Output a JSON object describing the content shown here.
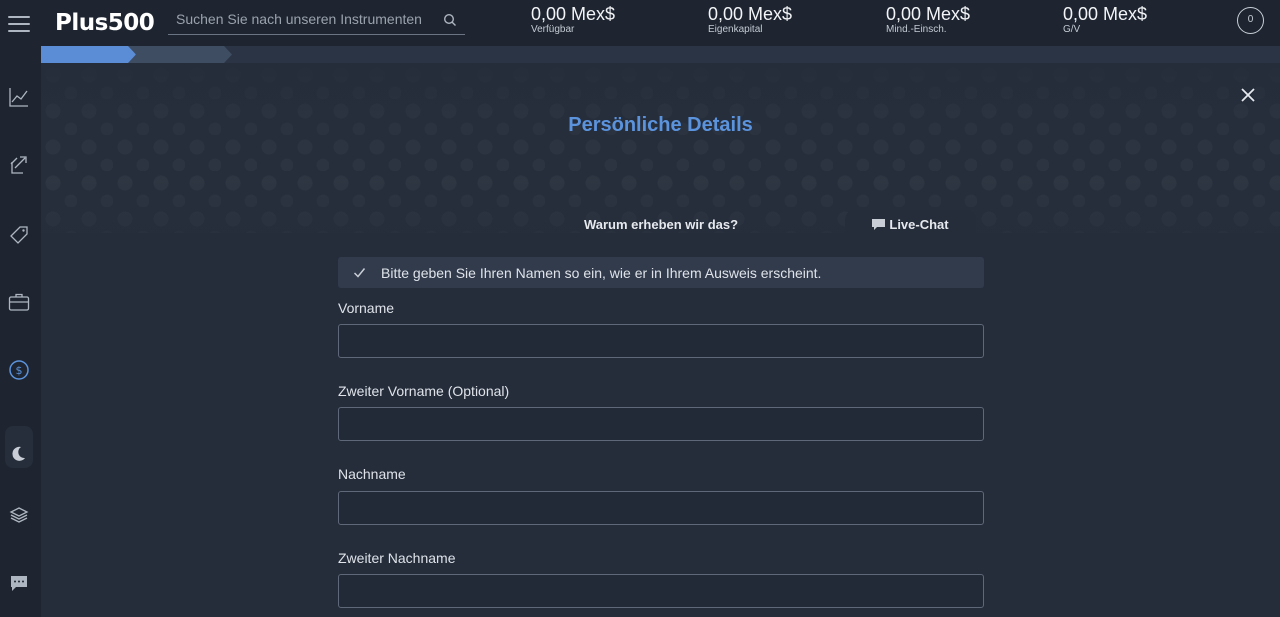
{
  "header": {
    "brand": "Plus500",
    "search": {
      "placeholder": "Suchen Sie nach unseren Instrumenten",
      "value": ""
    },
    "stats": [
      {
        "value": "0,00 Mex$",
        "label": "Verfügbar"
      },
      {
        "value": "0,00 Mex$",
        "label": "Eigenkapital"
      },
      {
        "value": "0,00 Mex$",
        "label": "Mind.-Einsch."
      },
      {
        "value": "0,00 Mex$",
        "label": "G/V"
      }
    ],
    "notification_count": "0"
  },
  "sidebar": {
    "icons": [
      "chart-line-icon",
      "trade-arrows-icon",
      "tag-icon",
      "briefcase-icon",
      "dollar-circle-icon",
      "moon-icon",
      "layers-icon",
      "chat-icon"
    ]
  },
  "progress": {
    "current_step": 1
  },
  "form": {
    "title": "Persönliche Details",
    "tabs": {
      "why": "Warum erheben wir das?",
      "chat": "Live-Chat"
    },
    "notice": "Bitte geben Sie Ihren Namen so ein, wie er in Ihrem Ausweis erscheint.",
    "fields": [
      {
        "label": "Vorname",
        "value": ""
      },
      {
        "label": "Zweiter Vorname (Optional)",
        "value": ""
      },
      {
        "label": "Nachname",
        "value": ""
      },
      {
        "label": "Zweiter Nachname",
        "value": ""
      }
    ]
  },
  "colors": {
    "accent": "#5b93dd",
    "background": "#252d3b",
    "header": "#1e2530"
  }
}
